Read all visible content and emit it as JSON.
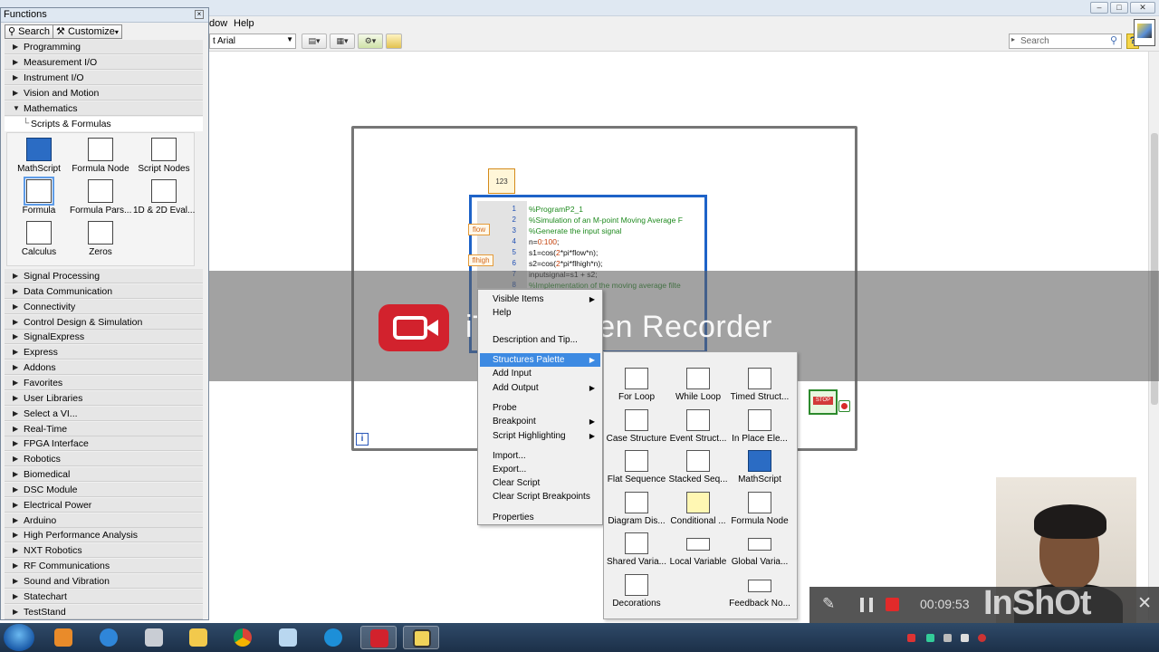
{
  "menu": {
    "window_partial": "dow",
    "help": "Help"
  },
  "toolbar": {
    "font": "t Arial",
    "search_placeholder": "Search"
  },
  "palette": {
    "title": "Functions",
    "search_btn": "Search",
    "customize_btn": "Customize",
    "top_categories": [
      "Programming",
      "Measurement I/O",
      "Instrument I/O",
      "Vision and Motion"
    ],
    "open_category": "Mathematics",
    "open_sub": "Scripts & Formulas",
    "grid_items": [
      "MathScript",
      "Formula Node",
      "Script Nodes",
      "Formula",
      "Formula Pars...",
      "1D & 2D Eval...",
      "Calculus",
      "Zeros"
    ],
    "bottom_categories": [
      "Signal Processing",
      "Data Communication",
      "Connectivity",
      "Control Design & Simulation",
      "SignalExpress",
      "Express",
      "Addons",
      "Favorites",
      "User Libraries",
      "Select a VI...",
      "Real-Time",
      "FPGA Interface",
      "Robotics",
      "Biomedical",
      "DSC Module",
      "Electrical Power",
      "Arduino",
      "High Performance Analysis",
      "NXT Robotics",
      "RF Communications",
      "Sound and Vibration",
      "Statechart",
      "TestStand"
    ]
  },
  "diagram": {
    "const_label": "123",
    "loop_index": "i",
    "terminals": [
      "flow",
      "flhigh"
    ],
    "code_lines": [
      {
        "n": "1",
        "parts": [
          {
            "t": "%ProgramP2_1",
            "c": "cmt"
          }
        ]
      },
      {
        "n": "2",
        "parts": [
          {
            "t": "%Simulation of an M-point Moving Average F",
            "c": "cmt"
          }
        ]
      },
      {
        "n": "3",
        "parts": [
          {
            "t": "%Generate the input signal",
            "c": "cmt"
          }
        ]
      },
      {
        "n": "4",
        "parts": [
          {
            "t": "n=",
            "c": "op"
          },
          {
            "t": "0:100",
            "c": "num"
          },
          {
            "t": ";",
            "c": "op"
          }
        ]
      },
      {
        "n": "5",
        "parts": [
          {
            "t": "s1=cos(",
            "c": "op"
          },
          {
            "t": "2",
            "c": "num"
          },
          {
            "t": "*pi*flow*n);",
            "c": "op"
          }
        ]
      },
      {
        "n": "6",
        "parts": [
          {
            "t": "s2=cos(",
            "c": "op"
          },
          {
            "t": "2",
            "c": "num"
          },
          {
            "t": "*pi*flhigh*n);",
            "c": "op"
          }
        ]
      },
      {
        "n": "7",
        "parts": [
          {
            "t": "inputsignal=s1 + s2;",
            "c": "op"
          }
        ]
      },
      {
        "n": "8",
        "parts": [
          {
            "t": "%Implementation of the moving average filte",
            "c": "cmt"
          }
        ]
      }
    ],
    "stop_label": "STOP"
  },
  "watermark": {
    "text": "iTop Screen Recorder"
  },
  "context_menu": {
    "items": [
      {
        "label": "Visible Items",
        "submenu": true
      },
      {
        "label": "Help",
        "submenu": false
      },
      {
        "label": "Description and Tip...",
        "submenu": false
      },
      {
        "label": "Structures Palette",
        "submenu": true,
        "active": true
      },
      {
        "label": "Add Input",
        "submenu": false
      },
      {
        "label": "Add Output",
        "submenu": true
      },
      {
        "label": "Probe",
        "submenu": false
      },
      {
        "label": "Breakpoint",
        "submenu": true
      },
      {
        "label": "Script Highlighting",
        "submenu": true
      },
      {
        "label": "Import...",
        "submenu": false
      },
      {
        "label": "Export...",
        "submenu": false
      },
      {
        "label": "Clear Script",
        "submenu": false
      },
      {
        "label": "Clear Script Breakpoints",
        "submenu": false
      },
      {
        "label": "Properties",
        "submenu": false
      }
    ]
  },
  "structures": {
    "items": [
      "For Loop",
      "While Loop",
      "Timed Struct...",
      "Case Structure",
      "Event Struct...",
      "In Place Ele...",
      "Flat Sequence",
      "Stacked Seq...",
      "MathScript",
      "Diagram Dis...",
      "Conditional ...",
      "Formula Node",
      "Shared Varia...",
      "Local Variable",
      "Global Varia...",
      "Decorations",
      "",
      "Feedback No..."
    ]
  },
  "recorder": {
    "time": "00:09:53",
    "brand": "InShOt"
  }
}
